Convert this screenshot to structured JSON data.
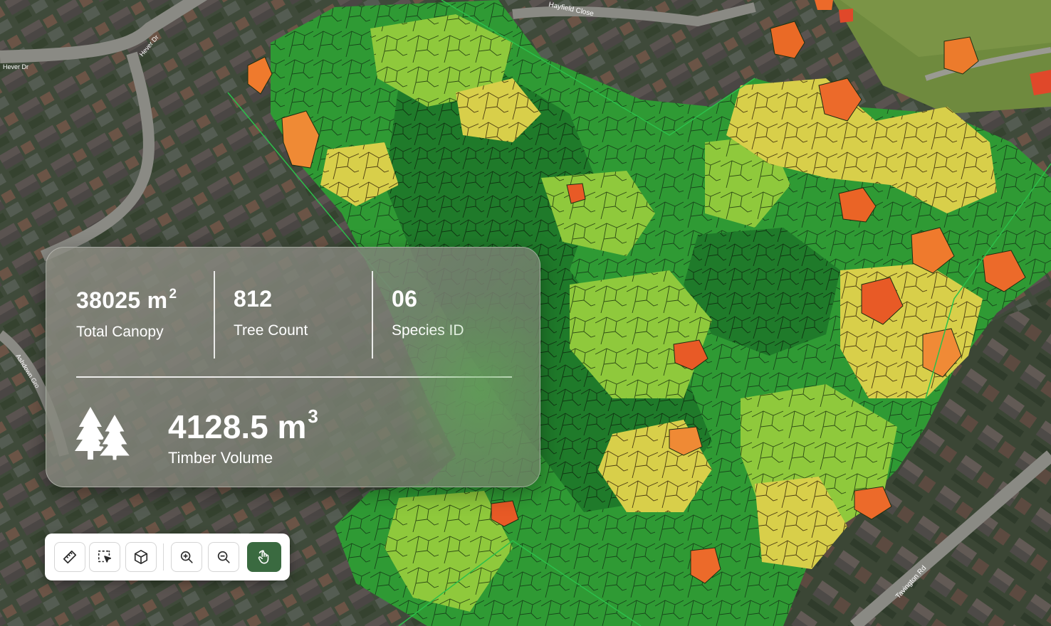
{
  "map": {
    "street_labels": [
      "Hayfield Close",
      "Hever Dr",
      "Hever Dr",
      "Ashdown Gro",
      "Tavington Rd"
    ],
    "colors": {
      "canopy_dark": "#1f7a2a",
      "canopy_mid": "#2f9a34",
      "canopy_light": "#7cc23a",
      "canopy_yellow": "#d2d84a",
      "canopy_orange": "#ee8a34",
      "canopy_red": "#e0482a",
      "outline": "#1b2e12"
    }
  },
  "stats": {
    "total_canopy": {
      "value": "38025 m",
      "unit_sup": "2",
      "label": "Total Canopy"
    },
    "tree_count": {
      "value": "812",
      "label": "Tree Count"
    },
    "species_id": {
      "value": "06",
      "label": "Species ID"
    },
    "timber_volume": {
      "value": "4128.5 m",
      "unit_sup": "3",
      "label": "Timber Volume",
      "icon": "trees-icon"
    }
  },
  "toolbar": {
    "tools": [
      {
        "name": "measure-tool-button",
        "icon": "ruler-icon",
        "active": false
      },
      {
        "name": "select-area-tool-button",
        "icon": "select-cursor-icon",
        "active": false
      },
      {
        "name": "3d-view-tool-button",
        "icon": "cube-icon",
        "active": false
      },
      {
        "name": "zoom-in-button",
        "icon": "zoom-in-icon",
        "active": false
      },
      {
        "name": "zoom-out-button",
        "icon": "zoom-out-icon",
        "active": false
      },
      {
        "name": "pan-tool-button",
        "icon": "hand-icon",
        "active": true
      }
    ],
    "colors": {
      "active_bg": "#3a6a40",
      "icon": "#2a2a2a"
    }
  }
}
